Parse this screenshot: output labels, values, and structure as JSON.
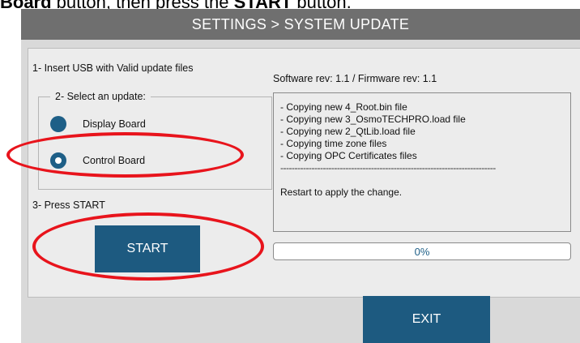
{
  "caption": {
    "prefix": "Board",
    "middle": " button, then press the ",
    "strong": "START",
    "suffix": " button."
  },
  "title": "SETTINGS > SYSTEM UPDATE",
  "steps": {
    "step1": "1- Insert USB with Valid update files",
    "step2": "2- Select an update:",
    "step3": "3- Press START"
  },
  "options": [
    {
      "label": "Display Board",
      "selected": false
    },
    {
      "label": "Control Board",
      "selected": true
    }
  ],
  "start_label": "START",
  "revision": "Software rev: 1.1  /  Firmware rev: 1.1",
  "log": {
    "lines": [
      "- Copying new 4_Root.bin file",
      "- Copying new 3_OsmoTECHPRO.load file",
      "- Copying new 2_QtLib.load file",
      "- Copying time zone files",
      "- Copying OPC Certificates files"
    ],
    "separator": "----------------------------------------------------------------------------",
    "restart": "Restart to apply the change."
  },
  "progress": {
    "value": 0,
    "label": "0%"
  },
  "exit_label": "EXIT",
  "colors": {
    "button": "#1d5a80",
    "title_bar": "#6f6f6f",
    "highlight": "#e8141c"
  }
}
